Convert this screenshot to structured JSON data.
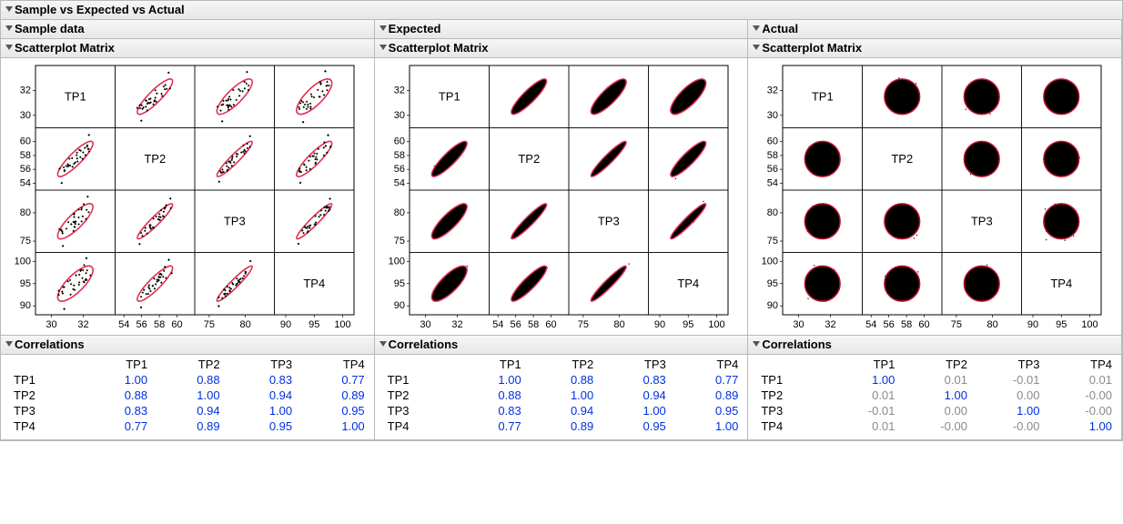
{
  "mainTitle": "Sample vs Expected vs Actual",
  "scatterplotTitle": "Scatterplot Matrix",
  "correlationsTitle": "Correlations",
  "vars": [
    "TP1",
    "TP2",
    "TP3",
    "TP4"
  ],
  "panels": [
    {
      "key": "sample",
      "title": "Sample data",
      "style": "sparse",
      "corr": [
        [
          "1.00",
          "0.88",
          "0.83",
          "0.77"
        ],
        [
          "0.88",
          "1.00",
          "0.94",
          "0.89"
        ],
        [
          "0.83",
          "0.94",
          "1.00",
          "0.95"
        ],
        [
          "0.77",
          "0.89",
          "0.95",
          "1.00"
        ]
      ]
    },
    {
      "key": "expected",
      "title": "Expected",
      "style": "dense",
      "corr": [
        [
          "1.00",
          "0.88",
          "0.83",
          "0.77"
        ],
        [
          "0.88",
          "1.00",
          "0.94",
          "0.89"
        ],
        [
          "0.83",
          "0.94",
          "1.00",
          "0.95"
        ],
        [
          "0.77",
          "0.89",
          "0.95",
          "1.00"
        ]
      ]
    },
    {
      "key": "actual",
      "title": "Actual",
      "style": "round",
      "corr": [
        [
          "1.00",
          "0.01",
          "-0.01",
          "0.01"
        ],
        [
          "0.01",
          "1.00",
          "0.00",
          "-0.00"
        ],
        [
          "-0.01",
          "0.00",
          "1.00",
          "-0.00"
        ],
        [
          "0.01",
          "-0.00",
          "-0.00",
          "1.00"
        ]
      ]
    }
  ],
  "axis": {
    "ranges": [
      {
        "min": 29,
        "max": 34,
        "ticks": [
          30,
          32
        ]
      },
      {
        "min": 53,
        "max": 62,
        "ticks": [
          54,
          56,
          58,
          60
        ]
      },
      {
        "min": 73,
        "max": 84,
        "ticks": [
          75,
          80
        ]
      },
      {
        "min": 88,
        "max": 102,
        "ticks": [
          90,
          95,
          100
        ]
      }
    ]
  },
  "colors": {
    "ellipse": "#e03050",
    "ellipseActual": "#c01030",
    "grid": "#000"
  },
  "chart_data": {
    "type": "scatter",
    "variables": [
      "TP1",
      "TP2",
      "TP3",
      "TP4"
    ],
    "axis_ranges": {
      "TP1": [
        29,
        34
      ],
      "TP2": [
        53,
        62
      ],
      "TP3": [
        73,
        84
      ],
      "TP4": [
        88,
        102
      ]
    },
    "axis_ticks": {
      "TP1": [
        30,
        32
      ],
      "TP2": [
        54,
        56,
        58,
        60
      ],
      "TP3": [
        75,
        80
      ],
      "TP4": [
        90,
        95,
        100
      ]
    },
    "panels": [
      {
        "name": "Sample data",
        "description": "sparse sample points with tight correlated ellipses",
        "correlation_matrix": [
          [
            1.0,
            0.88,
            0.83,
            0.77
          ],
          [
            0.88,
            1.0,
            0.94,
            0.89
          ],
          [
            0.83,
            0.94,
            1.0,
            0.95
          ],
          [
            0.77,
            0.89,
            0.95,
            1.0
          ]
        ]
      },
      {
        "name": "Expected",
        "description": "dense simulated correlated cloud, ellipses match sample",
        "correlation_matrix": [
          [
            1.0,
            0.88,
            0.83,
            0.77
          ],
          [
            0.88,
            1.0,
            0.94,
            0.89
          ],
          [
            0.83,
            0.94,
            1.0,
            0.95
          ],
          [
            0.77,
            0.89,
            0.95,
            1.0
          ]
        ]
      },
      {
        "name": "Actual",
        "description": "dense near-zero-correlation round clouds",
        "correlation_matrix": [
          [
            1.0,
            0.01,
            -0.01,
            0.01
          ],
          [
            0.01,
            1.0,
            0.0,
            -0.0
          ],
          [
            -0.01,
            0.0,
            1.0,
            -0.0
          ],
          [
            0.01,
            -0.0,
            -0.0,
            1.0
          ]
        ]
      }
    ]
  }
}
